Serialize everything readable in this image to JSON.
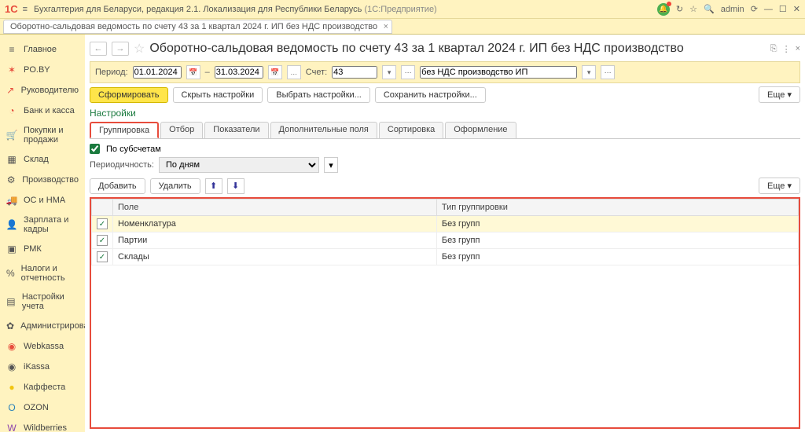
{
  "titlebar": {
    "logo": "1C",
    "title": "Бухгалтерия для Беларуси, редакция 2.1. Локализация для Республики Беларусь",
    "subtitle": "(1С:Предприятие)",
    "user": "admin"
  },
  "tabs_open": [
    {
      "label": "Оборотно-сальдовая ведомость по счету 43 за 1 квартал 2024 г. ИП без НДС производство"
    }
  ],
  "sidebar": {
    "items": [
      {
        "icon": "≡",
        "label": "Главное",
        "color": "#555"
      },
      {
        "icon": "✶",
        "label": "PO.BY",
        "color": "#e74c3c"
      },
      {
        "icon": "↗",
        "label": "Руководителю",
        "color": "#e74c3c"
      },
      {
        "icon": "◔",
        "label": "Банк и касса",
        "color": "#e74c3c"
      },
      {
        "icon": "🛒",
        "label": "Покупки и продажи",
        "color": "#555"
      },
      {
        "icon": "▦",
        "label": "Склад",
        "color": "#555"
      },
      {
        "icon": "⚙",
        "label": "Производство",
        "color": "#555"
      },
      {
        "icon": "🚚",
        "label": "ОС и НМА",
        "color": "#555"
      },
      {
        "icon": "👤",
        "label": "Зарплата и кадры",
        "color": "#555"
      },
      {
        "icon": "▣",
        "label": "РМК",
        "color": "#555"
      },
      {
        "icon": "%",
        "label": "Налоги и отчетность",
        "color": "#555"
      },
      {
        "icon": "▤",
        "label": "Настройки учета",
        "color": "#555"
      },
      {
        "icon": "✿",
        "label": "Администрирование",
        "color": "#555"
      },
      {
        "icon": "◉",
        "label": "Webkassa",
        "color": "#e74c3c"
      },
      {
        "icon": "◉",
        "label": "iKassa",
        "color": "#555"
      },
      {
        "icon": "●",
        "label": "Каффеста",
        "color": "#f1c40f"
      },
      {
        "icon": "O",
        "label": "OZON",
        "color": "#2980b9"
      },
      {
        "icon": "W",
        "label": "Wildberries",
        "color": "#8e44ad"
      }
    ]
  },
  "page": {
    "title": "Оборотно-сальдовая ведомость по счету 43 за 1 квартал 2024 г. ИП без НДС производство"
  },
  "period": {
    "label": "Период:",
    "from": "01.01.2024",
    "to": "31.03.2024",
    "account_label": "Счет:",
    "account": "43",
    "description": "без НДС производство ИП"
  },
  "actions": {
    "generate": "Сформировать",
    "hide": "Скрыть настройки",
    "choose": "Выбрать настройки...",
    "save": "Сохранить настройки...",
    "more": "Еще ▾"
  },
  "settings_title": "Настройки",
  "settings_tabs": [
    "Группировка",
    "Отбор",
    "Показатели",
    "Дополнительные поля",
    "Сортировка",
    "Оформление"
  ],
  "subaccounts": {
    "label": "По субсчетам",
    "checked": true
  },
  "periodicity": {
    "label": "Периодичность:",
    "value": "По дням"
  },
  "tbl_actions": {
    "add": "Добавить",
    "del": "Удалить",
    "more": "Еще ▾"
  },
  "columns": {
    "field": "Поле",
    "type": "Тип группировки"
  },
  "rows": [
    {
      "checked": true,
      "field": "Номенклатура",
      "type": "Без групп"
    },
    {
      "checked": true,
      "field": "Партии",
      "type": "Без групп"
    },
    {
      "checked": true,
      "field": "Склады",
      "type": "Без групп"
    }
  ]
}
